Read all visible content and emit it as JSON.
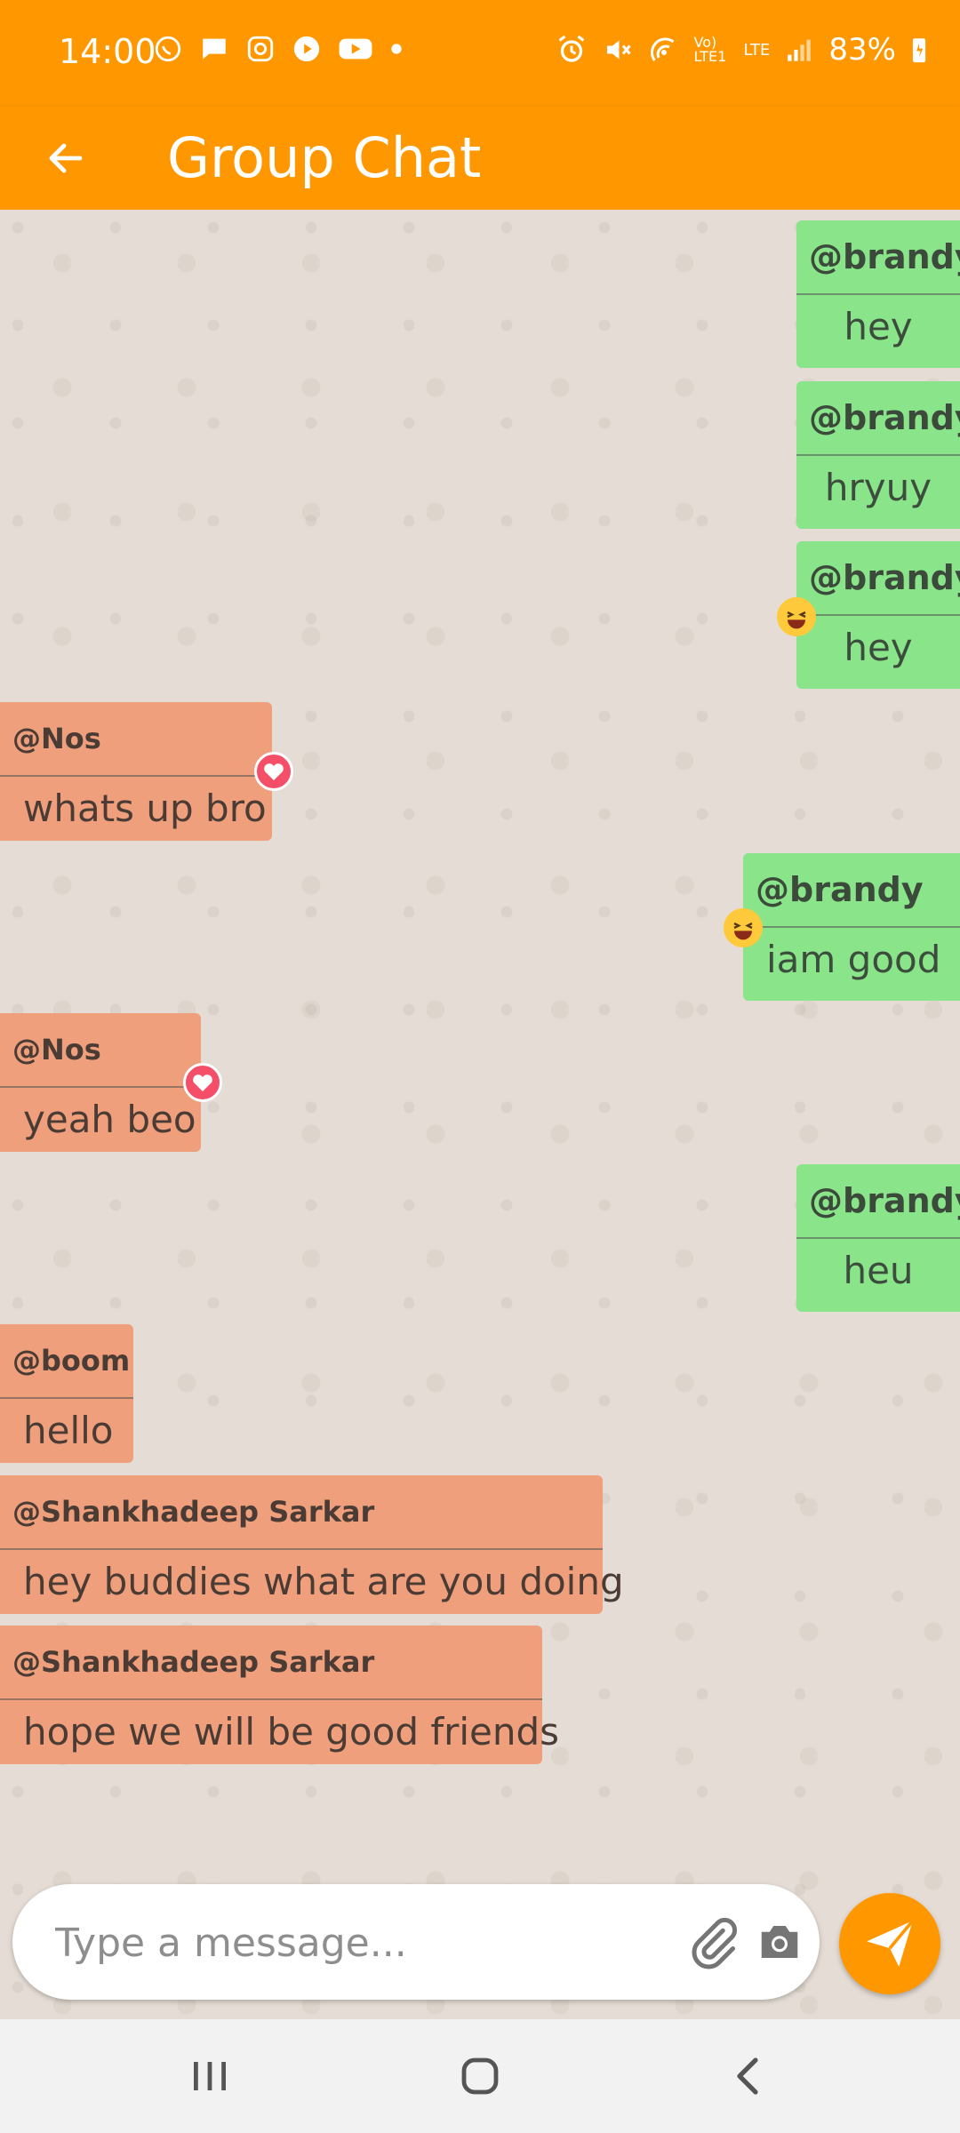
{
  "status_bar": {
    "time": "14:00",
    "battery": "83%",
    "left_icons": [
      "whatsapp-icon",
      "message-icon",
      "instagram-icon",
      "play-icon",
      "youtube-icon",
      "dot-icon"
    ],
    "right_icons": [
      "alarm-icon",
      "mute-icon",
      "hotspot-icon",
      "volte-icon",
      "lte-icon",
      "signal-icon",
      "battery-icon"
    ],
    "volte_text": "Vo) LTE1",
    "lte_text": "LTE"
  },
  "app_bar": {
    "title": "Group Chat",
    "background": "#FF9800"
  },
  "messages": [
    {
      "sender": "@brandy",
      "text": "hey",
      "direction": "out"
    },
    {
      "sender": "@brandy",
      "text": "hryuy",
      "direction": "out"
    },
    {
      "sender": "@brandy",
      "text": "hey",
      "direction": "out",
      "reaction": "laugh-emoji"
    },
    {
      "sender": "@Nos",
      "text": "whats up bro",
      "direction": "in",
      "reaction": "heart"
    },
    {
      "sender": "@brandy",
      "text": "iam good",
      "direction": "out",
      "reaction": "laugh-emoji"
    },
    {
      "sender": "@Nos",
      "text": "yeah beo",
      "direction": "in",
      "reaction": "heart"
    },
    {
      "sender": "@brandy",
      "text": "heu",
      "direction": "out"
    },
    {
      "sender": "@boom",
      "text": "hello",
      "direction": "in"
    },
    {
      "sender": "@Shankhadeep Sarkar",
      "text": "hey buddies what are you doing",
      "direction": "in"
    },
    {
      "sender": "@Shankhadeep Sarkar",
      "text": "hope we will be good friends",
      "direction": "in"
    }
  ],
  "composer": {
    "placeholder": "Type a message...",
    "value": ""
  },
  "colors": {
    "accent": "#FF9800",
    "outgoing_bubble": "#8AE58A",
    "incoming_bubble": "#EF9F7B",
    "chat_background": "#E5DDD5"
  }
}
